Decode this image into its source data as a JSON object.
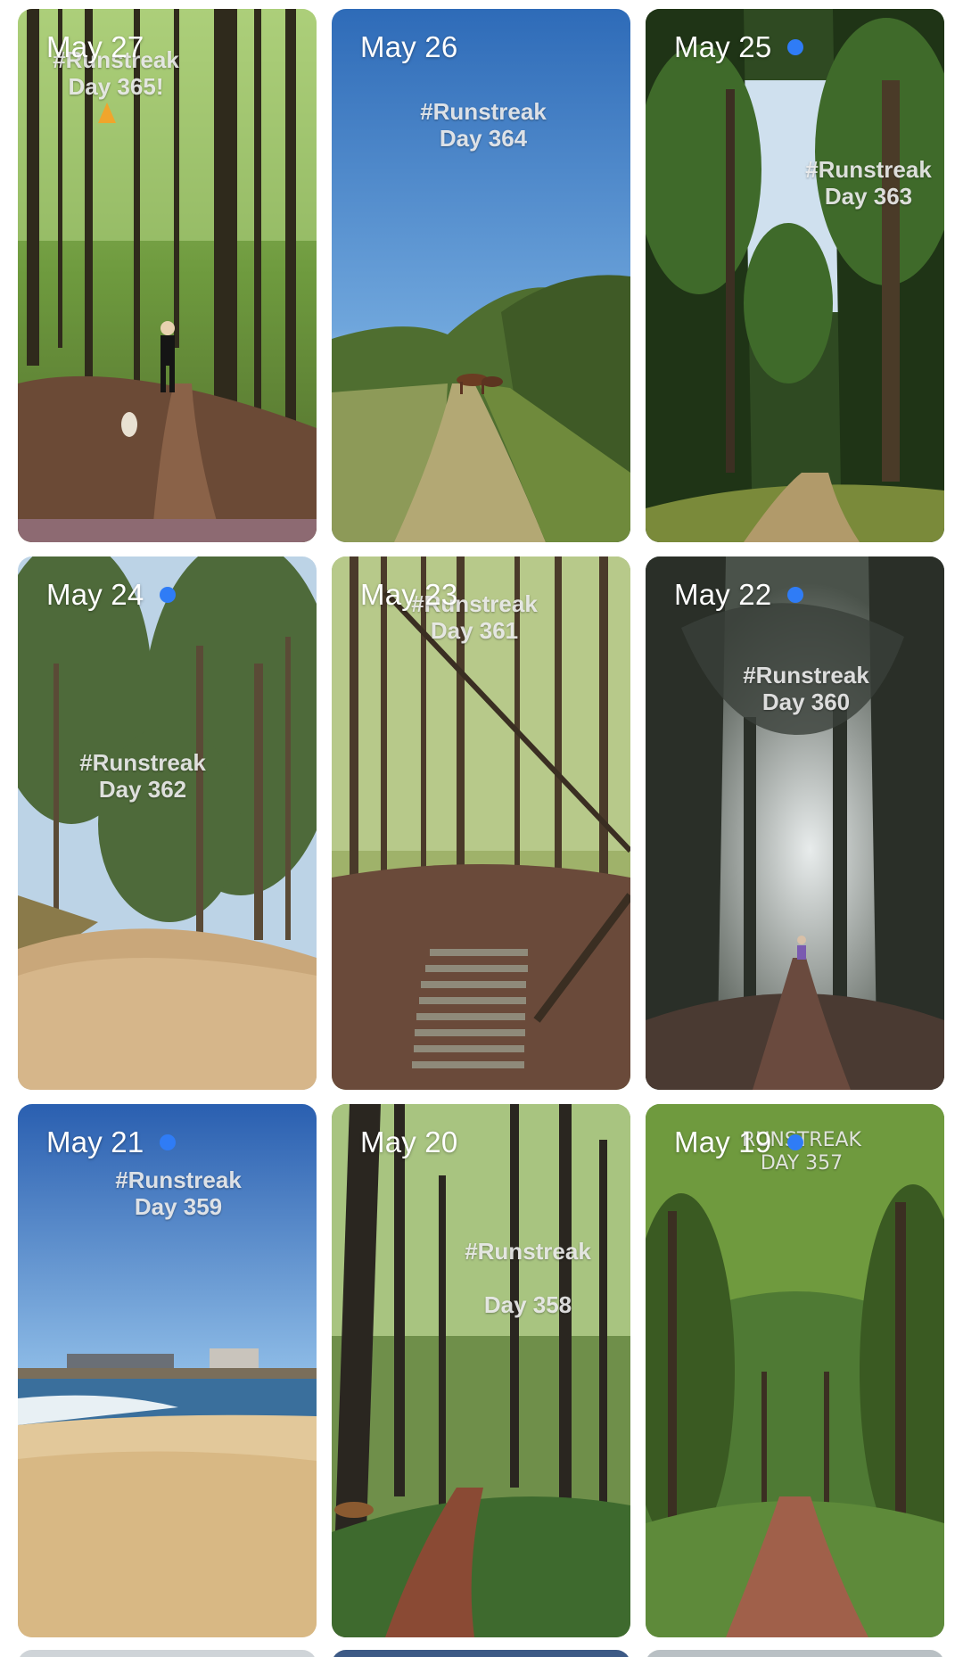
{
  "tiles": [
    {
      "date": "May 27",
      "has_dot": false,
      "caption": "#Runstreak\nDay 365!",
      "scene": "forest-runner-dog"
    },
    {
      "date": "May 26",
      "has_dot": false,
      "caption": "#Runstreak\nDay 364",
      "scene": "path-horses-blue-sky"
    },
    {
      "date": "May 25",
      "has_dot": true,
      "caption": "#Runstreak\nDay 363",
      "scene": "tall-trees-path"
    },
    {
      "date": "May 24",
      "has_dot": true,
      "caption": "#Runstreak\nDay 362",
      "scene": "eucalyptus-sand-path"
    },
    {
      "date": "May 23",
      "has_dot": false,
      "caption": "#Runstreak\nDay 361",
      "scene": "forest-log-steps"
    },
    {
      "date": "May 22",
      "has_dot": true,
      "caption": "#Runstreak\nDay 360",
      "scene": "misty-forest-runner"
    },
    {
      "date": "May 21",
      "has_dot": true,
      "caption": "#Runstreak\nDay 359",
      "scene": "beach"
    },
    {
      "date": "May 20",
      "has_dot": false,
      "caption": "#Runstreak\n\nDay 358",
      "scene": "green-forest-dog"
    },
    {
      "date": "May 19",
      "has_dot": true,
      "caption": "RUNSTREAK\nDAY 357",
      "scene": "green-tunnel-path"
    }
  ],
  "colors": {
    "dot": "#2f7cf6",
    "background": "#ffffff"
  }
}
